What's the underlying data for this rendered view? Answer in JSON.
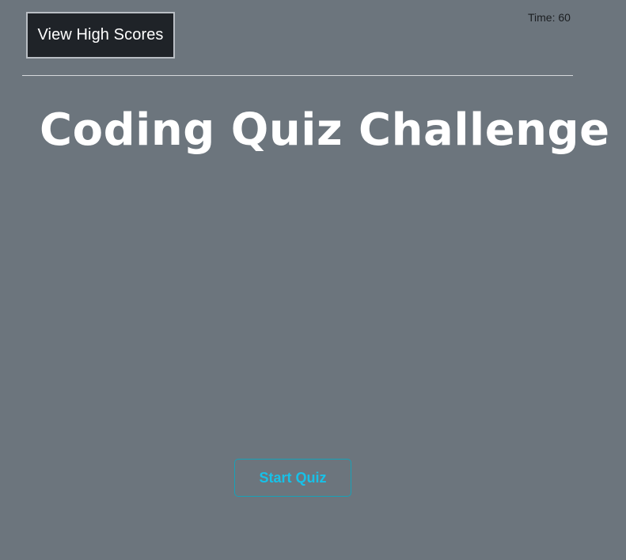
{
  "header": {
    "high_scores_label": "View High Scores",
    "timer_text": "Time: 60"
  },
  "main": {
    "title": "Coding Quiz Challenge",
    "start_label": "Start Quiz"
  },
  "colors": {
    "background": "#6c757d",
    "button_dark": "#1f2328",
    "accent": "#17a2b8",
    "title_text": "#ffffff"
  }
}
